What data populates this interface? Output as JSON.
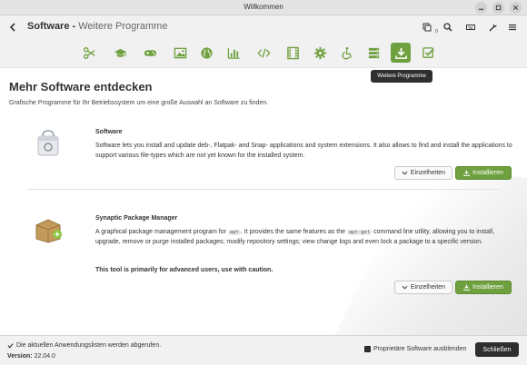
{
  "window": {
    "title": "Willkommen"
  },
  "header": {
    "title": "Software",
    "separator": " - ",
    "subtitle": "Weitere Programme",
    "count_badge": "0"
  },
  "categories": [
    {
      "icon": "scissors-icon"
    },
    {
      "icon": "graduation-cap-icon"
    },
    {
      "icon": "gamepad-icon"
    },
    {
      "icon": "image-icon"
    },
    {
      "icon": "globe-icon"
    },
    {
      "icon": "bar-chart-icon"
    },
    {
      "icon": "code-icon"
    },
    {
      "icon": "film-icon"
    },
    {
      "icon": "gear-icon"
    },
    {
      "icon": "accessibility-icon"
    },
    {
      "icon": "server-icon"
    },
    {
      "icon": "download-icon",
      "active": true
    },
    {
      "icon": "check-square-icon"
    }
  ],
  "tooltip": "Weitere Programme",
  "main": {
    "title": "Mehr Software entdecken",
    "description": "Grafische Programme für Ihr Betriebssystem um eine große Auswahl an Software zu finden."
  },
  "entries": [
    {
      "name": "Software",
      "desc": "Software lets you install and update deb-, Flatpak- and Snap- applications and system extensions. It also allows to find and install the applications to support various file-types which are not yet known for the installed system."
    },
    {
      "name": "Synaptic Package Manager",
      "desc_1": "A graphical package management program for ",
      "code_1": "apt",
      "desc_2": ". It provides the same features as the ",
      "code_2": "apt-get",
      "desc_3": " command line utility, allowing you to install, upgrade, remove or purge installed packages; modify repository settings; view change logs and even lock a package to a specific version.",
      "warning": "This tool is primarily for advanced users, use with caution."
    }
  ],
  "buttons": {
    "info": "Einzelheiten",
    "install": "Installieren"
  },
  "footer": {
    "status": "Die aktuellen Anwendungslisten werden abgerufen.",
    "version_label": "Version:",
    "version_value": "22.04.0",
    "proprietary_label": "Proprietäre Software ausblenden",
    "close": "Schließen"
  },
  "colors": {
    "accent": "#6fa03f",
    "dark_button": "#2e2e2e"
  }
}
